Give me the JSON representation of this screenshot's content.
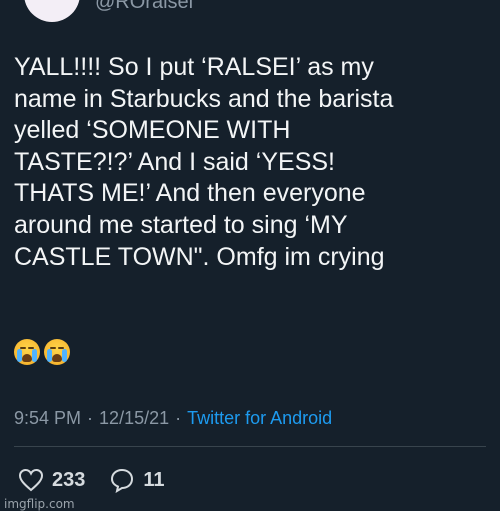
{
  "header": {
    "handle": "@ROralsel"
  },
  "tweet": {
    "text": "YALL!!!! So I put ‘RALSEI’ as my\nname in Starbucks and the barista\nyelled ‘SOMEONE WITH\nTASTE?!?’ And I said ‘YESS!\nTHATS ME!’ And then everyone\naround me started to sing ‘MY\nCASTLE TOWN\". Omfg im crying",
    "emojis": [
      "loudly-crying-face",
      "loudly-crying-face"
    ]
  },
  "meta": {
    "time": "9:54 PM",
    "separator1": "·",
    "date": "12/15/21",
    "separator2": "·",
    "source": "Twitter for Android"
  },
  "actions": {
    "likes": "233",
    "replies": "11"
  },
  "watermark": "imgflip.com",
  "colors": {
    "background": "#15202b",
    "text": "#f7f9f9",
    "secondary": "#8b98a5",
    "link": "#1d9bf0",
    "divider": "#38444d"
  }
}
